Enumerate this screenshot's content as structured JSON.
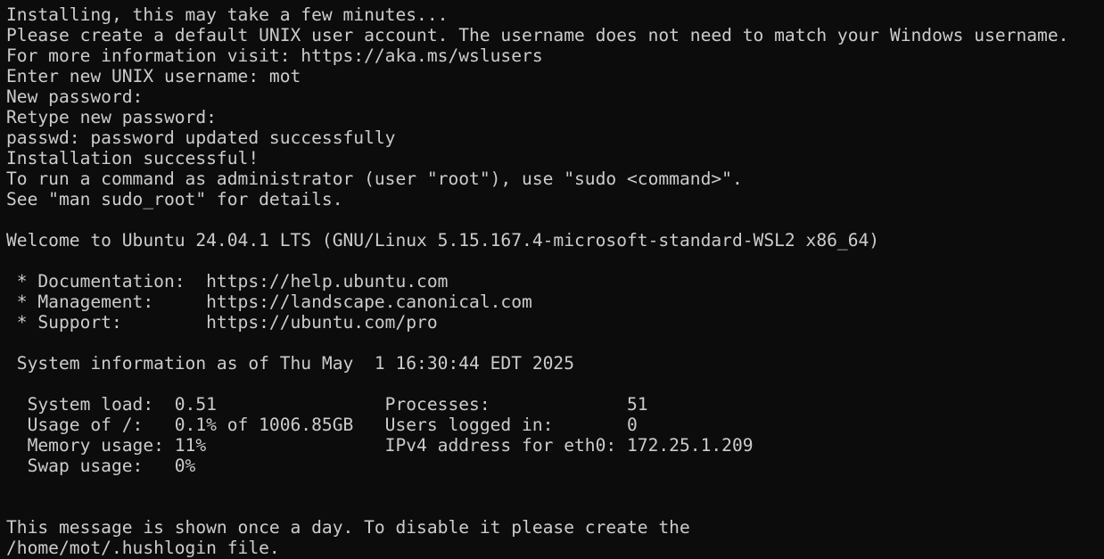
{
  "terminal": {
    "lines": [
      "Installing, this may take a few minutes...",
      "Please create a default UNIX user account. The username does not need to match your Windows username.",
      "For more information visit: https://aka.ms/wslusers",
      "Enter new UNIX username: mot",
      "New password:",
      "Retype new password:",
      "passwd: password updated successfully",
      "Installation successful!",
      "To run a command as administrator (user \"root\"), use \"sudo <command>\".",
      "See \"man sudo_root\" for details.",
      "",
      "Welcome to Ubuntu 24.04.1 LTS (GNU/Linux 5.15.167.4-microsoft-standard-WSL2 x86_64)",
      "",
      " * Documentation:  https://help.ubuntu.com",
      " * Management:     https://landscape.canonical.com",
      " * Support:        https://ubuntu.com/pro",
      "",
      " System information as of Thu May  1 16:30:44 EDT 2025",
      "",
      "  System load:  0.51                Processes:             51",
      "  Usage of /:   0.1% of 1006.85GB   Users logged in:       0",
      "  Memory usage: 11%                 IPv4 address for eth0: 172.25.1.209",
      "  Swap usage:   0%",
      "",
      "",
      "This message is shown once a day. To disable it please create the",
      "/home/mot/.hushlogin file."
    ]
  }
}
